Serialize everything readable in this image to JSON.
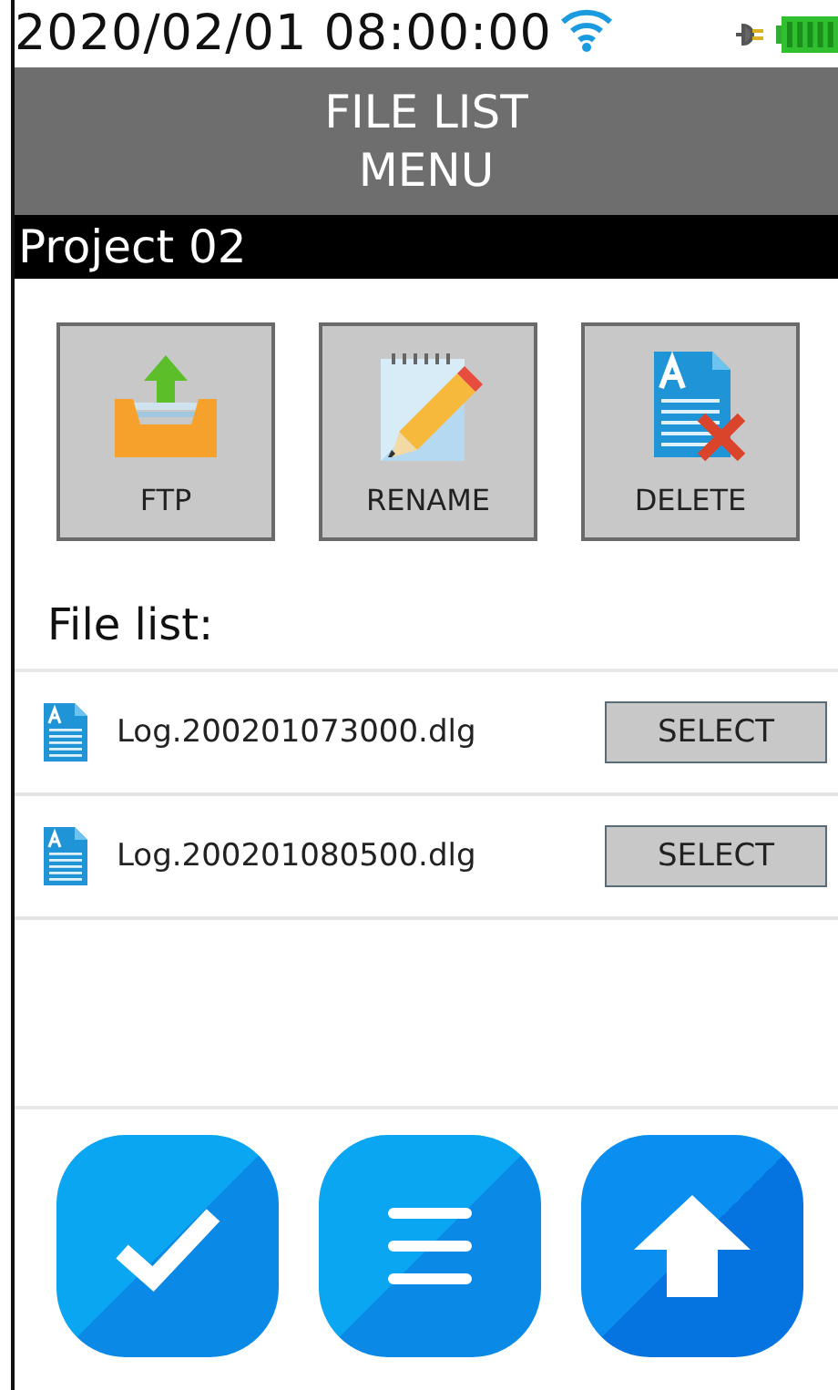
{
  "status_bar": {
    "datetime": "2020/02/01 08:00:00"
  },
  "header": {
    "title": "FILE LIST",
    "subtitle": "MENU"
  },
  "project": {
    "name": "Project 02"
  },
  "actions": [
    {
      "kind": "ftp",
      "label": "FTP"
    },
    {
      "kind": "rename",
      "label": "RENAME"
    },
    {
      "kind": "delete",
      "label": "DELETE"
    }
  ],
  "file_list": {
    "heading": "File list:",
    "files": [
      {
        "name": "Log.200201073000.dlg",
        "button": "SELECT"
      },
      {
        "name": "Log.200201080500.dlg",
        "button": "SELECT"
      }
    ]
  },
  "bottom_buttons": [
    {
      "kind": "check"
    },
    {
      "kind": "menu"
    },
    {
      "kind": "up"
    }
  ]
}
